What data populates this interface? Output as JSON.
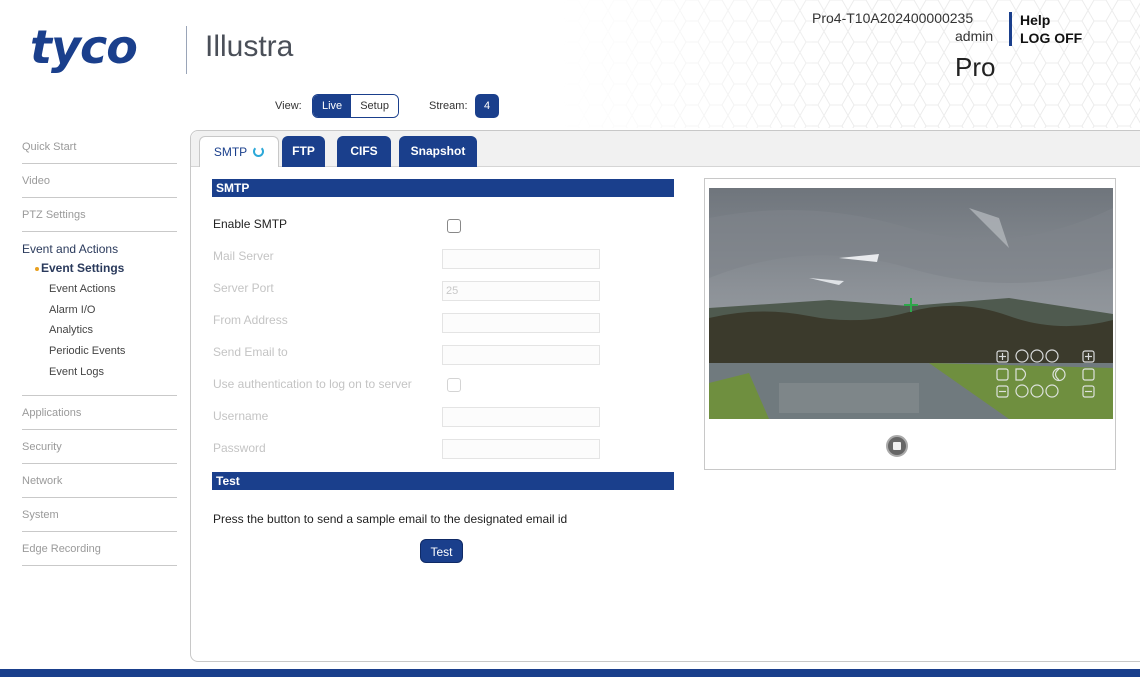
{
  "brand": {
    "logo": "tyco",
    "product_line": "Illustra"
  },
  "header": {
    "view_label": "View:",
    "view_options": [
      "Live",
      "Setup"
    ],
    "view_selected": "Live",
    "stream_label": "Stream:",
    "stream_value": "4",
    "device_name": "Pro4-T10A202400000235",
    "user": "admin",
    "product": "Pro",
    "help": "Help",
    "logoff": "LOG OFF"
  },
  "sidebar": {
    "items_top": [
      "Quick Start",
      "Video",
      "PTZ Settings"
    ],
    "group": {
      "title": "Event and Actions",
      "items": [
        "Event Settings",
        "Event Actions",
        "Alarm I/O",
        "Analytics",
        "Periodic Events",
        "Event Logs"
      ],
      "active": "Event Settings"
    },
    "items_bottom": [
      "Applications",
      "Security",
      "Network",
      "System",
      "Edge Recording"
    ]
  },
  "tabs": [
    {
      "label": "SMTP",
      "active": true
    },
    {
      "label": "FTP",
      "active": false
    },
    {
      "label": "CIFS",
      "active": false
    },
    {
      "label": "Snapshot",
      "active": false
    }
  ],
  "smtp": {
    "section_title": "SMTP",
    "enable_label": "Enable SMTP",
    "enable_checked": false,
    "mail_server_label": "Mail Server",
    "mail_server_value": "",
    "server_port_label": "Server Port",
    "server_port_value": "25",
    "from_address_label": "From Address",
    "from_address_value": "",
    "send_email_label": "Send Email to",
    "send_email_value": "",
    "auth_label": "Use authentication to log on to server",
    "auth_checked": false,
    "username_label": "Username",
    "username_value": "",
    "password_label": "Password",
    "password_value": ""
  },
  "test": {
    "section_title": "Test",
    "description": "Press the button to send a sample email to the designated email id",
    "button_label": "Test"
  },
  "colors": {
    "brand_blue": "#1a3f8c",
    "accent_orange": "#e8a020",
    "refresh_cyan": "#2ba8d8"
  },
  "icons": [
    "refresh-icon",
    "stop-icon",
    "zoom-in-icon",
    "zoom-out-icon",
    "focus-icon",
    "iris-icon",
    "crosshair-icon"
  ]
}
